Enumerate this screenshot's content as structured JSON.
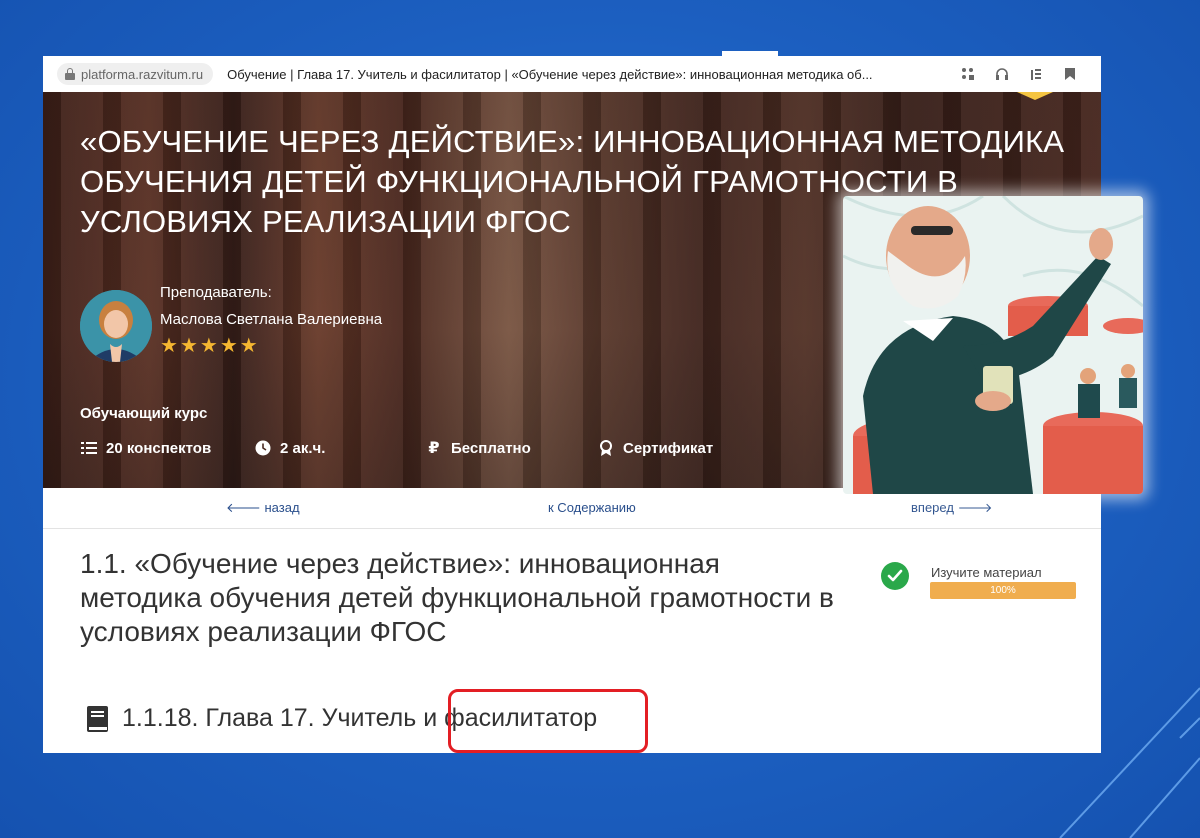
{
  "browser": {
    "url": "platforma.razvitum.ru",
    "tab_title": "Обучение | Глава 17. Учитель и фасилитатор | «Обучение через действие»: инновационная методика об..."
  },
  "hero": {
    "title": "«ОБУЧЕНИЕ ЧЕРЕЗ ДЕЙСТВИЕ»: ИННОВАЦИОННАЯ МЕТОДИКА ОБУЧЕНИЯ ДЕТЕЙ ФУНКЦИОНАЛЬНОЙ ГРАМОТНОСТИ В УСЛОВИЯХ РЕАЛИЗАЦИИ ФГОС",
    "teacher_label": "Преподаватель:",
    "teacher_name": "Маслова Светлана Валериевна",
    "rating": 5,
    "course_type": "Обучающий курс",
    "meta": {
      "notes": "20 конспектов",
      "hours": "2 ак.ч.",
      "price": "Бесплатно",
      "certificate": "Сертификат"
    }
  },
  "nav": {
    "back": "назад",
    "contents": "к Содержанию",
    "forward": "вперед"
  },
  "lesson": {
    "title": "1.1. «Обучение через действие»: инновационная методика обучения детей функциональной грамотности в условиях реализации ФГОС",
    "status_label": "Изучите материал",
    "progress": "100%",
    "chapter": "1.1.18. Глава 17. Учитель и фасилитатор"
  },
  "colors": {
    "background": "#1e63c6",
    "accent_star": "#f5b731",
    "progress": "#f0ad4e",
    "check": "#2aa84a",
    "highlight": "#e31e24",
    "link": "#2a4f8c"
  }
}
